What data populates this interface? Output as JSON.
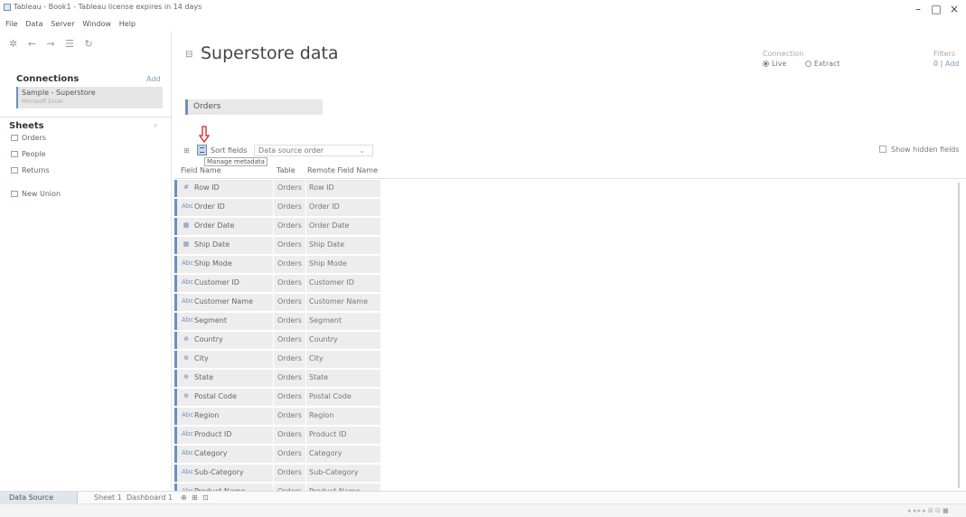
{
  "window": {
    "title": "Tableau - Book1 - Tableau license expires in 14 days",
    "minimize": "–",
    "maximize": "□",
    "close": "×"
  },
  "menu": [
    "File",
    "Data",
    "Server",
    "Window",
    "Help"
  ],
  "left_pane": {
    "toolbar_icons": [
      "tableau-logo-icon",
      "back-arrow-icon",
      "forward-arrow-icon",
      "save-icon",
      "refresh-icon"
    ],
    "connections_label": "Connections",
    "add_label": "Add",
    "connection_name": "Sample - Superstore",
    "connection_type": "Microsoft Excel",
    "sheets_label": "Sheets",
    "sheets": [
      {
        "label": "Orders",
        "icon": "table-icon"
      },
      {
        "label": "People",
        "icon": "table-icon"
      },
      {
        "label": "Returns",
        "icon": "table-icon"
      }
    ],
    "new_union": "New Union"
  },
  "header": {
    "title": "Superstore data",
    "connection_label": "Connection",
    "live": "Live",
    "extract": "Extract",
    "filters_label": "Filters",
    "filters_count": "0",
    "filters_add": "Add"
  },
  "canvas": {
    "table_name": "Orders"
  },
  "grid_toolbar": {
    "sort_label": "Sort fields",
    "sort_value": "Data source order",
    "show_hidden": "Show hidden fields",
    "tooltip": "Manage metadata"
  },
  "grid": {
    "headers": [
      "Field Name",
      "Table",
      "Remote Field Name"
    ],
    "rows": [
      {
        "type": "#",
        "field": "Row ID",
        "table": "Orders",
        "remote": "Row ID"
      },
      {
        "type": "Abc",
        "field": "Order ID",
        "table": "Orders",
        "remote": "Order ID"
      },
      {
        "type": "▦",
        "field": "Order Date",
        "table": "Orders",
        "remote": "Order Date"
      },
      {
        "type": "▦",
        "field": "Ship Date",
        "table": "Orders",
        "remote": "Ship Date"
      },
      {
        "type": "Abc",
        "field": "Ship Mode",
        "table": "Orders",
        "remote": "Ship Mode"
      },
      {
        "type": "Abc",
        "field": "Customer ID",
        "table": "Orders",
        "remote": "Customer ID"
      },
      {
        "type": "Abc",
        "field": "Customer Name",
        "table": "Orders",
        "remote": "Customer Name"
      },
      {
        "type": "Abc",
        "field": "Segment",
        "table": "Orders",
        "remote": "Segment"
      },
      {
        "type": "⊕",
        "field": "Country",
        "table": "Orders",
        "remote": "Country"
      },
      {
        "type": "⊕",
        "field": "City",
        "table": "Orders",
        "remote": "City"
      },
      {
        "type": "⊕",
        "field": "State",
        "table": "Orders",
        "remote": "State"
      },
      {
        "type": "⊕",
        "field": "Postal Code",
        "table": "Orders",
        "remote": "Postal Code"
      },
      {
        "type": "Abc",
        "field": "Region",
        "table": "Orders",
        "remote": "Region"
      },
      {
        "type": "Abc",
        "field": "Product ID",
        "table": "Orders",
        "remote": "Product ID"
      },
      {
        "type": "Abc",
        "field": "Category",
        "table": "Orders",
        "remote": "Category"
      },
      {
        "type": "Abc",
        "field": "Sub-Category",
        "table": "Orders",
        "remote": "Sub-Category"
      },
      {
        "type": "Abc",
        "field": "Product Name",
        "table": "Orders",
        "remote": "Product Name"
      }
    ]
  },
  "bottom_tabs": {
    "data_source": "Data Source",
    "sheet1": "Sheet 1",
    "dashboard1": "Dashboard 1"
  },
  "colors": {
    "accent": "#6d8fba",
    "annotation_arrow": "#e02020"
  }
}
